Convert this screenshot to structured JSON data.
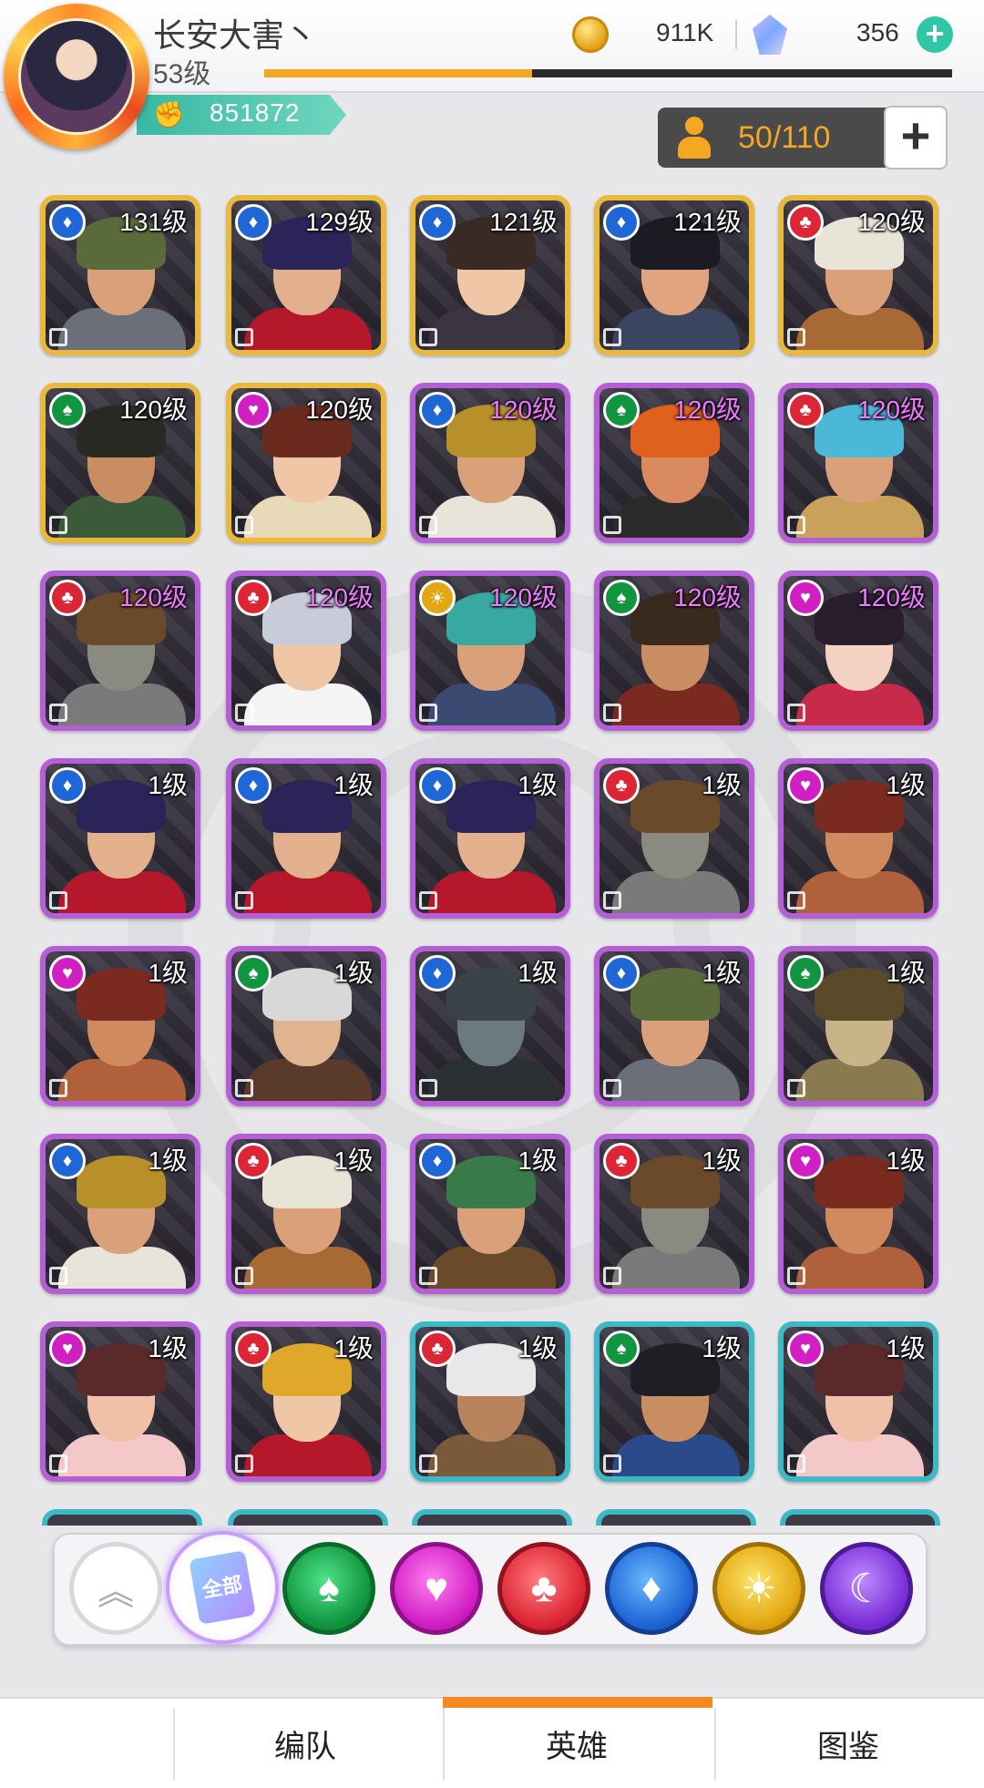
{
  "player": {
    "name": "长安大害丶",
    "level": "53级",
    "exp_progress": 0.39,
    "power": "851872"
  },
  "resources": {
    "coins": "911K",
    "gems": "356",
    "coin_icon": "coin-icon",
    "gem_icon": "gem-icon"
  },
  "hero_capacity": {
    "text": "50/110"
  },
  "faction_colors": {
    "blue": "#1f66d6",
    "red": "#dc2535",
    "green": "#11953f",
    "pink": "#d21fc4",
    "yellow": "#e2a711"
  },
  "heroes": [
    {
      "level": "131级",
      "faction": "blue",
      "frame": "gold",
      "skin": "#d9a07a",
      "hair": "#5a6a3a",
      "outfit": "#6b6f7a"
    },
    {
      "level": "129级",
      "faction": "blue",
      "frame": "gold",
      "skin": "#e3b08e",
      "hair": "#2a2458",
      "outfit": "#b5182a"
    },
    {
      "level": "121级",
      "faction": "blue",
      "frame": "gold",
      "skin": "#f0c7a6",
      "hair": "#3a2a24",
      "outfit": "#3a3540"
    },
    {
      "level": "121级",
      "faction": "blue",
      "frame": "gold",
      "skin": "#e0a57e",
      "hair": "#1b1b24",
      "outfit": "#3a4660"
    },
    {
      "level": "120级",
      "faction": "red",
      "frame": "gold",
      "skin": "#d9a07a",
      "hair": "#e9e4d8",
      "outfit": "#a86a34"
    },
    {
      "level": "120级",
      "faction": "green",
      "frame": "gold",
      "skin": "#c98d62",
      "hair": "#2a2a24",
      "outfit": "#3a5a3a"
    },
    {
      "level": "120级",
      "faction": "pink",
      "frame": "gold",
      "skin": "#f0c7a6",
      "hair": "#6a2a1e",
      "outfit": "#e8d9b8"
    },
    {
      "level": "120级",
      "faction": "blue",
      "frame": "purple",
      "skin": "#d9a07a",
      "hair": "#b8902a",
      "outfit": "#e8e4da"
    },
    {
      "level": "120级",
      "faction": "green",
      "frame": "purple",
      "skin": "#d98a5e",
      "hair": "#e0601e",
      "outfit": "#2a2a2a"
    },
    {
      "level": "120级",
      "faction": "red",
      "frame": "purple",
      "skin": "#d9a07a",
      "hair": "#4bb8d8",
      "outfit": "#c9a15a"
    },
    {
      "level": "120级",
      "faction": "red",
      "frame": "purple",
      "skin": "#8a8a80",
      "hair": "#6a4a2a",
      "outfit": "#7a7a7a"
    },
    {
      "level": "120级",
      "faction": "red",
      "frame": "purple",
      "skin": "#f0c7a6",
      "hair": "#c8ccd8",
      "outfit": "#f4f4f4"
    },
    {
      "level": "120级",
      "faction": "yellow",
      "frame": "purple",
      "skin": "#d9a07a",
      "hair": "#39a8a0",
      "outfit": "#3a4a70"
    },
    {
      "level": "120级",
      "faction": "green",
      "frame": "purple",
      "skin": "#c98d62",
      "hair": "#3a2a1e",
      "outfit": "#7a2a1e"
    },
    {
      "level": "120级",
      "faction": "pink",
      "frame": "purple",
      "skin": "#f4d2c2",
      "hair": "#2a1e2e",
      "outfit": "#c82a4a"
    },
    {
      "level": "1级",
      "faction": "blue",
      "frame": "purple",
      "skin": "#e3b08e",
      "hair": "#2a2458",
      "outfit": "#b5182a"
    },
    {
      "level": "1级",
      "faction": "blue",
      "frame": "purple",
      "skin": "#e3b08e",
      "hair": "#2a2458",
      "outfit": "#b5182a"
    },
    {
      "level": "1级",
      "faction": "blue",
      "frame": "purple",
      "skin": "#e3b08e",
      "hair": "#2a2458",
      "outfit": "#b5182a"
    },
    {
      "level": "1级",
      "faction": "red",
      "frame": "purple",
      "skin": "#8a8a80",
      "hair": "#6a4a2a",
      "outfit": "#7a7a7a"
    },
    {
      "level": "1级",
      "faction": "pink",
      "frame": "purple",
      "skin": "#d08a5e",
      "hair": "#7a2a1e",
      "outfit": "#b0603a"
    },
    {
      "level": "1级",
      "faction": "pink",
      "frame": "purple",
      "skin": "#d08a5e",
      "hair": "#7a2a1e",
      "outfit": "#b0603a"
    },
    {
      "level": "1级",
      "faction": "green",
      "frame": "purple",
      "skin": "#e0b490",
      "hair": "#d8d8d8",
      "outfit": "#5a3a2a"
    },
    {
      "level": "1级",
      "faction": "blue",
      "frame": "purple",
      "skin": "#6a7a80",
      "hair": "#3a4448",
      "outfit": "#2a3034"
    },
    {
      "level": "1级",
      "faction": "blue",
      "frame": "purple",
      "skin": "#d9a07a",
      "hair": "#5a6a3a",
      "outfit": "#6b6f7a"
    },
    {
      "level": "1级",
      "faction": "green",
      "frame": "purple",
      "skin": "#c9b48a",
      "hair": "#5a4a2a",
      "outfit": "#8a7a50"
    },
    {
      "level": "1级",
      "faction": "blue",
      "frame": "purple",
      "skin": "#d9a07a",
      "hair": "#b8902a",
      "outfit": "#e8e4da"
    },
    {
      "level": "1级",
      "faction": "red",
      "frame": "purple",
      "skin": "#d9a07a",
      "hair": "#e9e4d8",
      "outfit": "#a86a34"
    },
    {
      "level": "1级",
      "faction": "blue",
      "frame": "purple",
      "skin": "#d9a07a",
      "hair": "#3a7a4a",
      "outfit": "#6a4a2a"
    },
    {
      "level": "1级",
      "faction": "red",
      "frame": "purple",
      "skin": "#8a8a80",
      "hair": "#6a4a2a",
      "outfit": "#7a7a7a"
    },
    {
      "level": "1级",
      "faction": "pink",
      "frame": "purple",
      "skin": "#d08a5e",
      "hair": "#7a2a1e",
      "outfit": "#b0603a"
    },
    {
      "level": "1级",
      "faction": "pink",
      "frame": "purple",
      "skin": "#f0c0a8",
      "hair": "#5a2a2a",
      "outfit": "#f4c8c8"
    },
    {
      "level": "1级",
      "faction": "red",
      "frame": "purple",
      "skin": "#f0c7a6",
      "hair": "#e0a82a",
      "outfit": "#b5182a"
    },
    {
      "level": "1级",
      "faction": "red",
      "frame": "teal",
      "skin": "#b8845e",
      "hair": "#e8e8e8",
      "outfit": "#7a5a3a"
    },
    {
      "level": "1级",
      "faction": "green",
      "frame": "teal",
      "skin": "#c98d62",
      "hair": "#1e1e24",
      "outfit": "#2a4a8a"
    },
    {
      "level": "1级",
      "faction": "pink",
      "frame": "teal",
      "skin": "#f0c0a8",
      "hair": "#5a2a2a",
      "outfit": "#f4c8c8"
    }
  ],
  "filters": {
    "all_label": "全部",
    "items": [
      {
        "name": "collapse-button",
        "icon": "double-chevron-up-icon"
      },
      {
        "name": "filter-all-button",
        "icon": "card-stack-icon"
      },
      {
        "name": "filter-green-button",
        "icon": "spade-icon"
      },
      {
        "name": "filter-pink-button",
        "icon": "heart-icon"
      },
      {
        "name": "filter-red-button",
        "icon": "club-icon"
      },
      {
        "name": "filter-blue-button",
        "icon": "diamond-icon"
      },
      {
        "name": "filter-yellow-button",
        "icon": "sun-icon"
      },
      {
        "name": "filter-moon-button",
        "icon": "moon-icon"
      }
    ]
  },
  "tabs": [
    {
      "label": "编队"
    },
    {
      "label": "英雄",
      "active": true
    },
    {
      "label": "图鉴"
    }
  ]
}
